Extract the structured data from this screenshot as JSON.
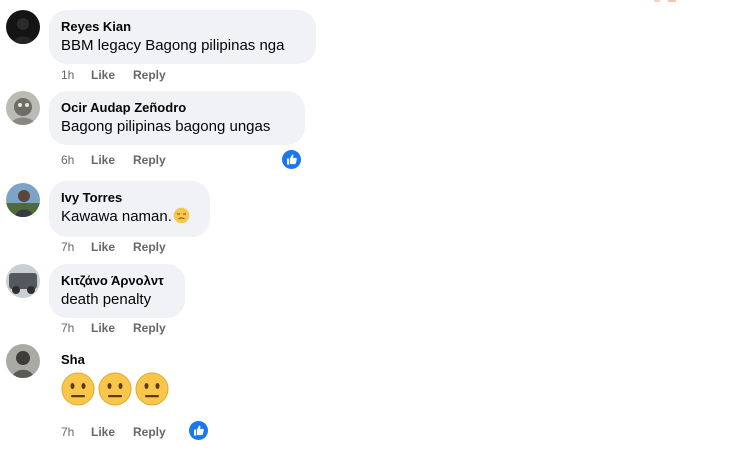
{
  "comments": [
    {
      "author": "Reyes Kian",
      "text": "BBM legacy Bagong pilipinas nga",
      "time": "1h",
      "like": "Like",
      "reply": "Reply"
    },
    {
      "author": "Ocir Audap Zeñodro",
      "text": "Bagong pilipinas bagong ungas",
      "time": "6h",
      "like": "Like",
      "reply": "Reply"
    },
    {
      "author": "Ivy Torres",
      "text": "Kawawa naman.",
      "time": "7h",
      "like": "Like",
      "reply": "Reply"
    },
    {
      "author": "Κιτζάνο Άρνολντ",
      "text": "death penalty",
      "time": "7h",
      "like": "Like",
      "reply": "Reply"
    },
    {
      "author": "Sha",
      "text": "",
      "time": "7h",
      "like": "Like",
      "reply": "Reply"
    }
  ],
  "icons": {
    "like_reaction": "thumbs-up-icon",
    "emoji_pensive": "pensive-face-emoji",
    "emoji_neutral": "neutral-face-emoji"
  },
  "colors": {
    "bubble": "#f0f2f5",
    "meta_text": "#65676b",
    "reaction_blue": "#1877f2"
  }
}
